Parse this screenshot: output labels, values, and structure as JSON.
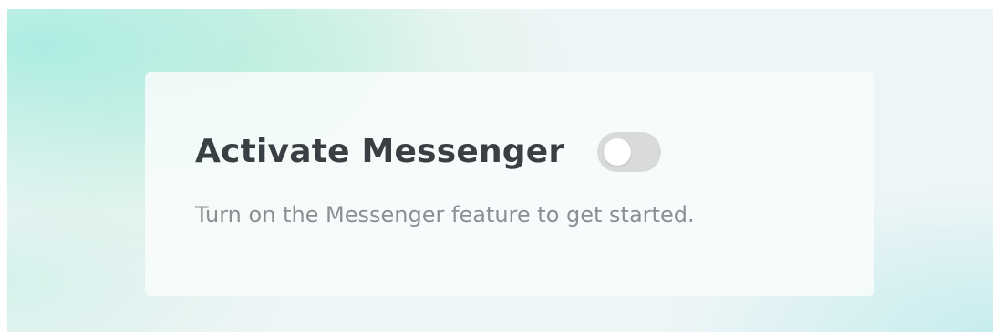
{
  "messenger_settings": {
    "title": "Activate Messenger",
    "description": "Turn on the Messenger feature to get started.",
    "toggle": {
      "state": "off",
      "track_color": "#d8dadb",
      "knob_color": "#ffffff"
    }
  }
}
